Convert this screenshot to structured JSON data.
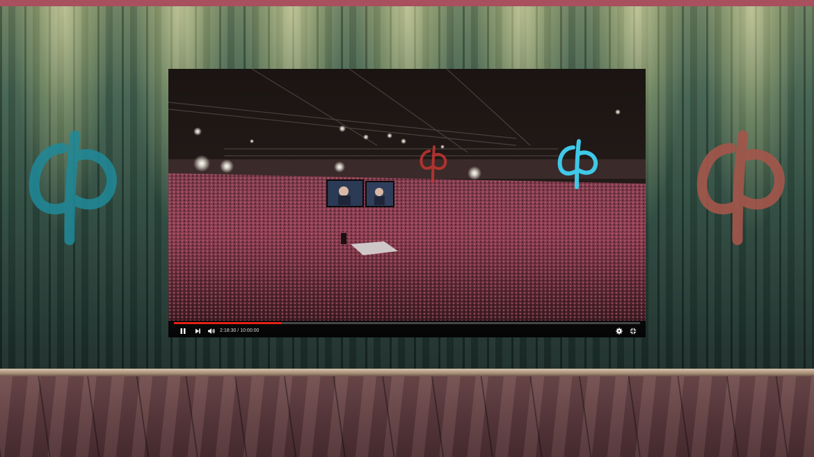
{
  "player": {
    "time_current": "2:18:30",
    "time_separator": " / ",
    "time_total": "10:00:00",
    "progress": 0.231,
    "state": "playing",
    "icons": {
      "pause": "pause-icon",
      "next": "next-icon",
      "volume": "volume-icon",
      "settings": "gear-icon",
      "exit_fullscreen": "exit-fullscreen-icon"
    },
    "progress_color": "#e62117"
  },
  "decor": {
    "logo_left_color": "#1f8a9a",
    "logo_right_color": "#a4564a",
    "screen_logo_color": "#3fc8e8",
    "screen_logo_red_color": "#c5352f"
  }
}
